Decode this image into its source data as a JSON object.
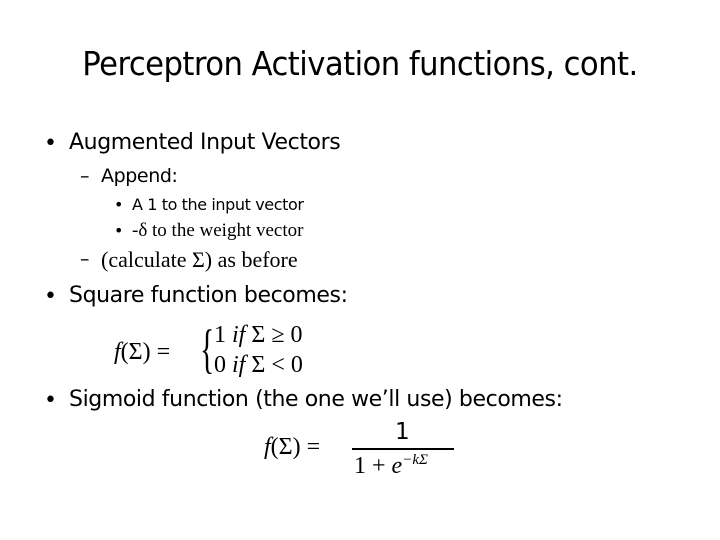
{
  "slide": {
    "title": "Perceptron Activation functions, cont.",
    "bullets": {
      "b1": {
        "marker": "•",
        "text": "Augmented Input Vectors"
      },
      "b1_1": {
        "marker": "–",
        "text": "Append:"
      },
      "b1_1_1": {
        "marker": "•",
        "text": "A 1 to the input vector"
      },
      "b1_1_2": {
        "marker": "•",
        "text": "-δ to the weight vector"
      },
      "b1_2": {
        "marker": "–",
        "text": "(calculate Σ) as before"
      },
      "b2": {
        "marker": "•",
        "text": "Square function becomes:"
      },
      "b3": {
        "marker": "•",
        "text": "Sigmoid function (the one we’ll use) becomes:"
      }
    },
    "square_formula": {
      "lhs_f": "f",
      "lhs_arg": "(Σ) =",
      "brace": "{",
      "case1": {
        "value": "1",
        "cond_if": "if",
        "cond": "Σ ≥ 0"
      },
      "case2": {
        "value": "0",
        "cond_if": "if",
        "cond": "Σ < 0"
      }
    },
    "sigmoid_formula": {
      "lhs_f": "f",
      "lhs_arg": "(Σ) =",
      "numerator": "1",
      "denominator_base": "1 + ",
      "denominator_e": "e",
      "exponent": "−kΣ"
    }
  }
}
